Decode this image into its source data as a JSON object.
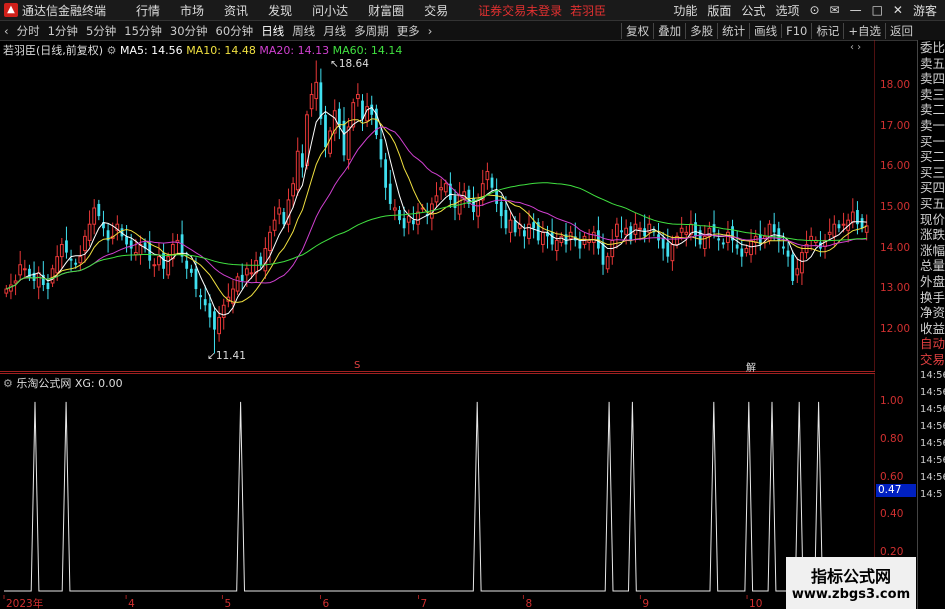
{
  "menubar": {
    "app_title": "通达信金融终端",
    "menus": [
      "行情",
      "市场",
      "资讯",
      "发现",
      "问小达",
      "财富圈",
      "交易"
    ],
    "warning": "证券交易未登录",
    "user_name": "若羽臣",
    "right_items": [
      "功能",
      "版面",
      "公式",
      "选项"
    ],
    "guest": "游客"
  },
  "periodbar": {
    "tabs": [
      "分时",
      "1分钟",
      "5分钟",
      "15分钟",
      "30分钟",
      "60分钟",
      "日线",
      "周线",
      "月线",
      "多周期",
      "更多"
    ],
    "active_tab": "日线",
    "tools": [
      "复权",
      "叠加",
      "多股",
      "统计",
      "画线",
      "F10",
      "标记",
      "+自选",
      "返回"
    ]
  },
  "info": {
    "stock": "若羽臣(日线,前复权)",
    "ma5": "MA5: 14.56",
    "ma10": "MA10: 14.48",
    "ma20": "MA20: 14.13",
    "ma60": "MA60: 14.14",
    "high_label": "18.64",
    "low_label": "11.41",
    "marker_s": "S",
    "marker_jie": "解"
  },
  "sub": {
    "title": "乐淘公式网",
    "xg": "XG: 0.00",
    "cursor_value": "0.47"
  },
  "right_panel": [
    "委比",
    "卖五",
    "卖四",
    "卖三",
    "卖二",
    "卖一",
    "买一",
    "买二",
    "买三",
    "买四",
    "买五",
    "现价",
    "涨跌",
    "涨幅",
    "总量",
    "外盘",
    "换手",
    "净资",
    "收益",
    "自动",
    "交易"
  ],
  "right_times": [
    "14:56",
    "14:56",
    "14:56",
    "14:56",
    "14:56",
    "14:56",
    "14:56",
    "14:5"
  ],
  "colors": {
    "up": "#e83838",
    "down": "#40e0f0",
    "ma5": "#ffffff",
    "ma10": "#f0e040",
    "ma20": "#d040d0",
    "ma60": "#40e040",
    "axis": "#d03030"
  },
  "watermark": {
    "line1": "指标公式网",
    "line2": "www.zbgs3.com"
  },
  "chart_data": [
    {
      "type": "candlestick",
      "y_ticks": [
        "18.00",
        "17.00",
        "16.00",
        "15.00",
        "14.00",
        "13.00",
        "12.00"
      ],
      "ylim": [
        11.2,
        18.8
      ],
      "x_labels": [
        "2023年",
        "4",
        "5",
        "6",
        "7",
        "8",
        "9",
        "10"
      ],
      "high": 18.64,
      "low": 11.41,
      "close": [
        13.0,
        13.1,
        13.2,
        13.6,
        13.5,
        13.3,
        13.2,
        13.4,
        13.1,
        13.0,
        13.5,
        13.8,
        14.1,
        13.9,
        13.7,
        13.6,
        13.8,
        14.3,
        14.6,
        15.0,
        14.8,
        14.5,
        14.2,
        14.3,
        14.6,
        14.3,
        14.1,
        14.0,
        13.9,
        14.1,
        14.0,
        13.7,
        13.6,
        13.8,
        13.5,
        13.8,
        14.1,
        14.2,
        13.8,
        13.5,
        13.4,
        13.0,
        12.8,
        12.6,
        12.3,
        12.0,
        12.3,
        12.6,
        12.8,
        13.0,
        13.3,
        13.2,
        13.5,
        13.4,
        13.7,
        13.6,
        14.0,
        14.4,
        14.7,
        15.0,
        14.6,
        15.2,
        15.6,
        16.4,
        16.0,
        17.3,
        17.8,
        18.1,
        17.2,
        16.5,
        16.9,
        17.4,
        17.0,
        16.3,
        17.0,
        17.6,
        17.8,
        17.2,
        17.5,
        17.3,
        16.8,
        16.2,
        15.5,
        15.1,
        15.0,
        14.7,
        14.5,
        14.8,
        14.6,
        14.9,
        15.0,
        14.8,
        15.1,
        15.3,
        15.5,
        15.6,
        15.2,
        15.0,
        15.3,
        15.4,
        15.1,
        14.9,
        15.2,
        15.6,
        15.9,
        15.5,
        15.1,
        14.8,
        14.5,
        14.7,
        14.4,
        14.6,
        14.3,
        14.6,
        14.5,
        14.2,
        14.4,
        14.3,
        14.1,
        14.2,
        14.3,
        14.1,
        14.4,
        14.2,
        14.0,
        14.3,
        14.2,
        14.4,
        14.0,
        13.6,
        13.8,
        14.2,
        14.6,
        14.4,
        14.5,
        14.2,
        14.6,
        14.5,
        14.3,
        14.6,
        14.4,
        14.2,
        14.0,
        13.8,
        14.1,
        14.3,
        14.5,
        14.4,
        14.6,
        14.3,
        14.1,
        14.3,
        14.5,
        14.4,
        14.2,
        14.1,
        14.4,
        14.2,
        14.0,
        13.8,
        14.0,
        14.2,
        14.3,
        14.1,
        14.3,
        14.6,
        14.4,
        14.2,
        14.0,
        13.8,
        13.2,
        13.5,
        13.9,
        14.1,
        14.3,
        14.2,
        14.0,
        14.2,
        14.4,
        14.6,
        14.5,
        14.6,
        14.7,
        14.9,
        14.6,
        14.5,
        14.56
      ],
      "ma5_last": 14.56,
      "ma10_last": 14.48,
      "ma20_last": 14.13,
      "ma60_last": 14.14
    },
    {
      "type": "line",
      "title": "乐淘公式网",
      "y_ticks": [
        "1.00",
        "0.80",
        "0.60",
        "0.40",
        "0.20"
      ],
      "ylim": [
        0,
        1.1
      ],
      "signal_indices": [
        8,
        16,
        61,
        122,
        156,
        162,
        183,
        192,
        198,
        205,
        210
      ],
      "length": 223
    }
  ]
}
